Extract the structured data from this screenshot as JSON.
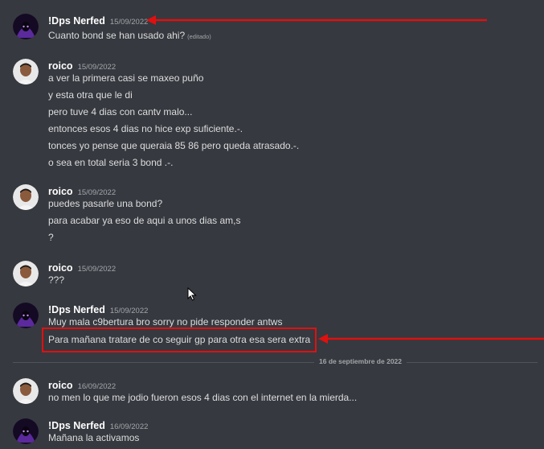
{
  "messages": [
    {
      "user": "!Dps Nerfed",
      "avatar": "dps-avatar",
      "time": "15/09/2022",
      "lines": [
        "Cuanto bond se han usado ahi?"
      ],
      "edited_label": "(editado)"
    },
    {
      "user": "roico",
      "avatar": "roico-avatar",
      "time": "15/09/2022",
      "lines": [
        "a ver la primera casi se maxeo puño",
        "y esta otra que le di",
        "pero tuve 4 dias con cantv malo...",
        "entonces esos 4 dias no hice exp suficiente.-.",
        "tonces yo pense que queraia 85 86 pero queda atrasado.-.",
        "o sea en total seria 3 bond .-."
      ]
    },
    {
      "user": "roico",
      "avatar": "roico-avatar",
      "time": "15/09/2022",
      "lines": [
        "puedes pasarle una bond?",
        "para acabar ya eso de aqui a unos dias am,s",
        "?"
      ]
    },
    {
      "user": "roico",
      "avatar": "roico-avatar",
      "time": "15/09/2022",
      "lines": [
        "???"
      ]
    },
    {
      "user": "!Dps Nerfed",
      "avatar": "dps-avatar",
      "time": "15/09/2022",
      "lines": [
        "Muy mala c9bertura bro sorry no pide responder antws",
        "Para mañana tratare de co seguir gp para otra esa sera extra"
      ]
    },
    {
      "user": "roico",
      "avatar": "roico-avatar",
      "time": "16/09/2022",
      "lines": [
        "no men lo que me jodio fueron esos 4 dias con el internet en la mierda..."
      ]
    },
    {
      "user": "!Dps Nerfed",
      "avatar": "dps-avatar",
      "time": "16/09/2022",
      "lines": [
        "Mañana la activamos"
      ]
    }
  ],
  "date_divider": "16 de septiembre de 2022",
  "colors": {
    "background": "#36393f",
    "username": "#ffffff",
    "text": "#dcddde",
    "muted": "#a3a6aa",
    "annotation": "#e01010"
  }
}
